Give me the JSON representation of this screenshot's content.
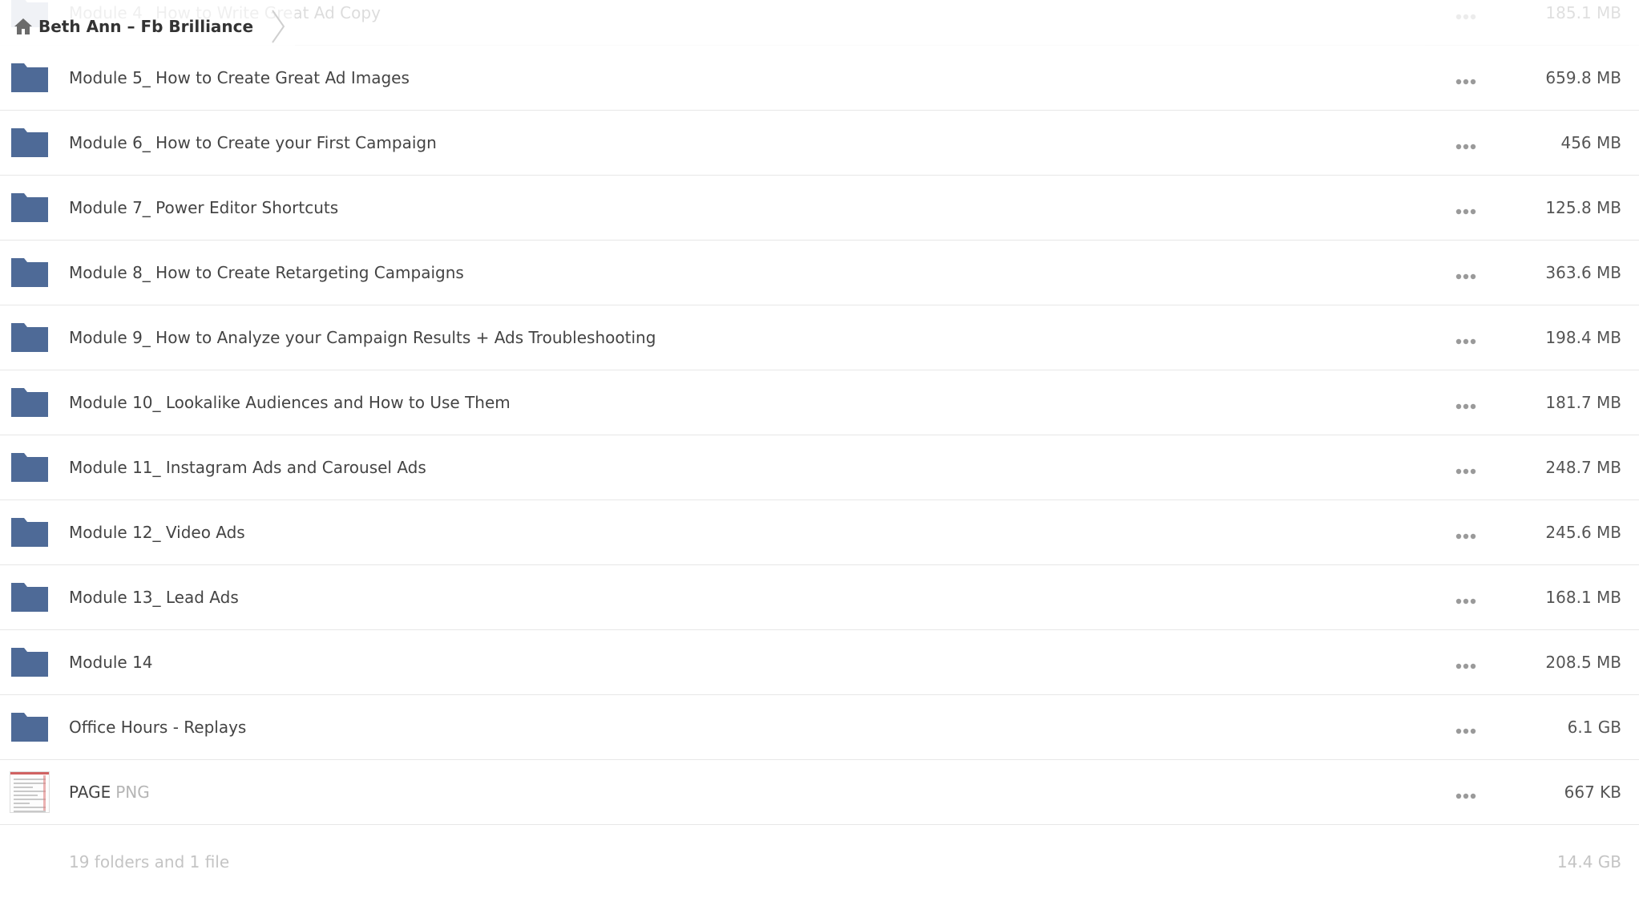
{
  "breadcrumb": {
    "label": "Beth Ann – Fb Brilliance"
  },
  "colors": {
    "folder": "#4e6a97",
    "more_dots": "#9a9a9a",
    "divider": "#e7e7e7"
  },
  "rows": [
    {
      "name": "Module 4_ How to Write Great Ad Copy",
      "size": "185.1 MB",
      "type": "folder"
    },
    {
      "name": "Module 5_ How to Create Great Ad Images",
      "size": "659.8 MB",
      "type": "folder"
    },
    {
      "name": "Module 6_ How to Create your First Campaign",
      "size": "456 MB",
      "type": "folder"
    },
    {
      "name": "Module 7_ Power Editor Shortcuts",
      "size": "125.8 MB",
      "type": "folder"
    },
    {
      "name": "Module 8_ How to Create Retargeting Campaigns",
      "size": "363.6 MB",
      "type": "folder"
    },
    {
      "name": "Module 9_ How to Analyze your Campaign Results + Ads Troubleshooting",
      "size": "198.4 MB",
      "type": "folder"
    },
    {
      "name": "Module 10_ Lookalike Audiences and How to Use Them",
      "size": "181.7 MB",
      "type": "folder"
    },
    {
      "name": "Module 11_ Instagram Ads and Carousel Ads",
      "size": "248.7 MB",
      "type": "folder"
    },
    {
      "name": "Module 12_ Video Ads",
      "size": "245.6 MB",
      "type": "folder"
    },
    {
      "name": "Module 13_ Lead Ads",
      "size": "168.1 MB",
      "type": "folder"
    },
    {
      "name": "Module 14",
      "size": "208.5 MB",
      "type": "folder"
    },
    {
      "name": "Office Hours - Replays",
      "size": "6.1 GB",
      "type": "folder"
    },
    {
      "name": "PAGE",
      "ext": "PNG",
      "size": "667 KB",
      "type": "file"
    }
  ],
  "summary": {
    "count": "19 folders and 1 file",
    "total": "14.4 GB"
  },
  "icons": {
    "home": "home-icon",
    "separator": "chevron-right-icon",
    "folder": "folder-icon",
    "more": "more-options-icon",
    "file": "image-thumbnail"
  }
}
